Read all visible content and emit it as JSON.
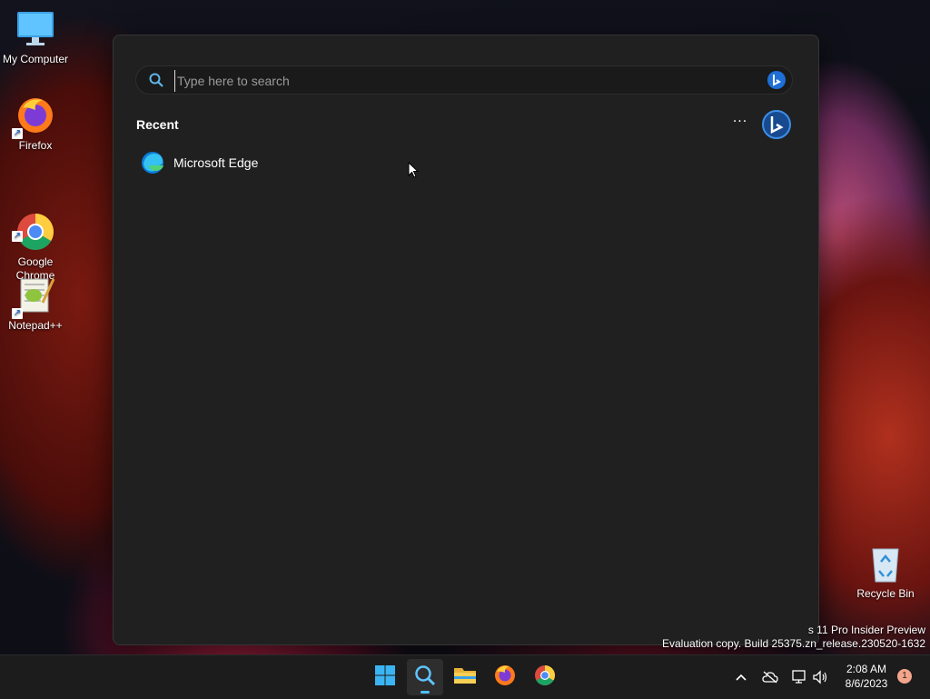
{
  "desktop": {
    "icons": [
      {
        "label": "My Computer",
        "icon": "computer-icon"
      },
      {
        "label": "Firefox",
        "icon": "firefox-icon"
      },
      {
        "label": "Google\nChrome",
        "icon": "chrome-icon"
      },
      {
        "label": "Notepad++",
        "icon": "notepad-plus-plus-icon"
      },
      {
        "label": "Recycle Bin",
        "icon": "recycle-bin-icon"
      }
    ]
  },
  "search": {
    "placeholder": "Type here to search",
    "value": "",
    "recent_title": "Recent",
    "more_label": "···",
    "recent_items": [
      {
        "label": "Microsoft Edge",
        "icon": "edge-icon"
      }
    ]
  },
  "watermark": {
    "line1": "s 11 Pro Insider Preview",
    "line2": "Evaluation copy. Build 25375.zn_release.230520-1632"
  },
  "taskbar": {
    "apps": [
      {
        "name": "Start",
        "icon": "windows-start-icon"
      },
      {
        "name": "Search",
        "icon": "search-icon",
        "active": true
      },
      {
        "name": "File Explorer",
        "icon": "folder-icon"
      },
      {
        "name": "Firefox",
        "icon": "firefox-icon"
      },
      {
        "name": "Google Chrome",
        "icon": "chrome-icon"
      }
    ],
    "tray": {
      "time": "2:08 AM",
      "date": "8/6/2023",
      "notifications": "1"
    }
  },
  "colors": {
    "flyout_bg": "#202020",
    "accent": "#4cc2ff",
    "taskbar_bg": "#1c1c1c"
  }
}
